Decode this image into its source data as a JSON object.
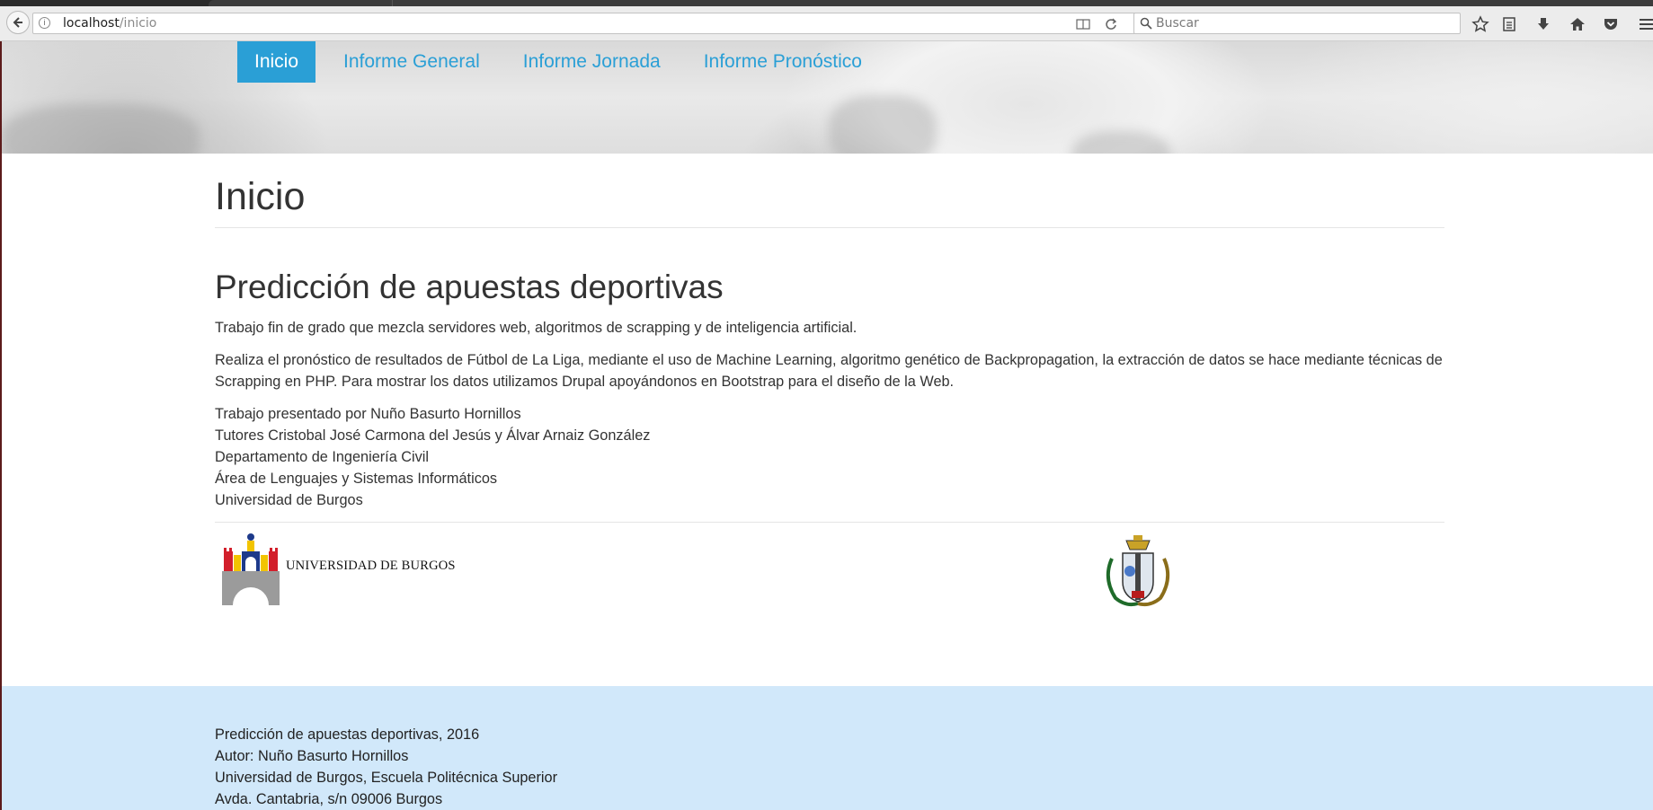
{
  "browser": {
    "url_host": "localhost",
    "url_path": "/inicio",
    "search_placeholder": "Buscar"
  },
  "nav": {
    "items": [
      {
        "label": "Inicio",
        "active": true
      },
      {
        "label": "Informe General",
        "active": false
      },
      {
        "label": "Informe Jornada",
        "active": false
      },
      {
        "label": "Informe Pronóstico",
        "active": false
      }
    ]
  },
  "page": {
    "title": "Inicio",
    "section_title": "Predicción de apuestas deportivas",
    "paragraph1": "Trabajo fin de grado que mezcla servidores web, algoritmos de scrapping y de inteligencia artificial.",
    "paragraph2": "Realiza el pronóstico de resultados de Fútbol de La Liga, mediante el uso de Machine Learning, algoritmo genético de Backpropagation, la extracción de datos se hace mediante técnicas de Scrapping en PHP. Para mostrar los datos utilizamos Drupal apoyándonos en Bootstrap para el diseño de la Web.",
    "credits": [
      "Trabajo presentado por Nuño Basurto Hornillos",
      "Tutores Cristobal José Carmona del Jesús y Álvar Arnaiz González",
      "Departamento de Ingeniería Civil",
      "Área de Lenguajes y Sistemas Informáticos",
      "Universidad de Burgos"
    ],
    "logo_text": "UNIVERSIDAD DE BURGOS"
  },
  "footer": {
    "lines": [
      "Predicción de apuestas deportivas, 2016",
      "Autor: Nuño Basurto Hornillos",
      "Universidad de Burgos, Escuela Politécnica Superior",
      "Avda. Cantabria, s/n 09006 Burgos"
    ]
  },
  "colors": {
    "accent": "#2a9fd6",
    "footer_bg": "#d1e8fa",
    "text": "#333333"
  }
}
